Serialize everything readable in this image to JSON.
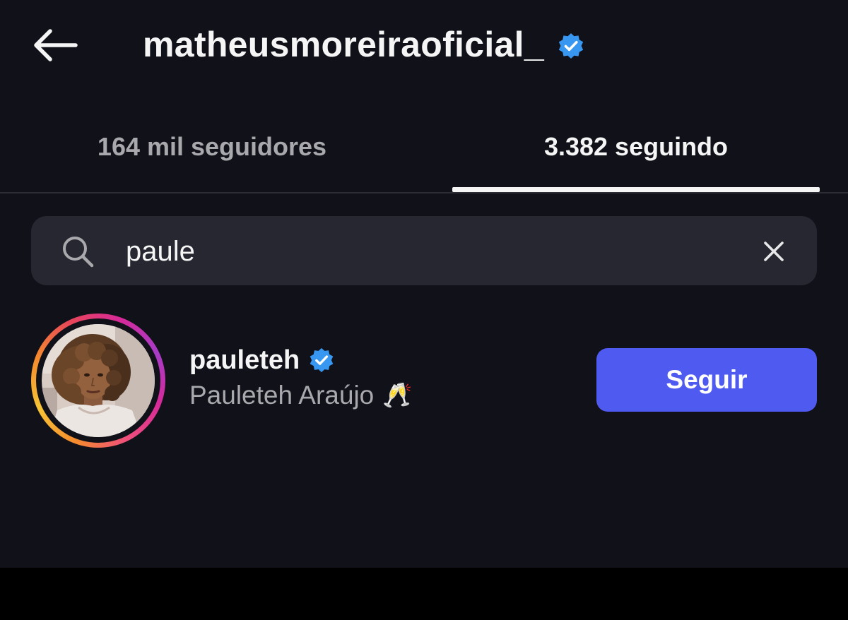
{
  "header": {
    "back_icon": "arrow-left-icon",
    "title": "matheusmoreiraoficial_",
    "verified_icon": "verified-badge-icon",
    "verified_color": "#3897f0"
  },
  "tabs": [
    {
      "label": "164 mil seguidores",
      "active": false
    },
    {
      "label": "3.382 seguindo",
      "active": true
    }
  ],
  "search": {
    "icon": "search-icon",
    "value": "paule",
    "clear_icon": "close-icon"
  },
  "results": [
    {
      "username": "pauleteh",
      "verified": true,
      "full_name": "Pauleteh Araújo",
      "emoji": "🥂",
      "follow_label": "Seguir",
      "follow_color": "#4f5bf0",
      "avatar_icon": "profile-photo"
    }
  ],
  "colors": {
    "background": "#101119",
    "search_background": "#262730",
    "primary_text": "#f5f5f5",
    "secondary_text": "#a8a8ad"
  }
}
